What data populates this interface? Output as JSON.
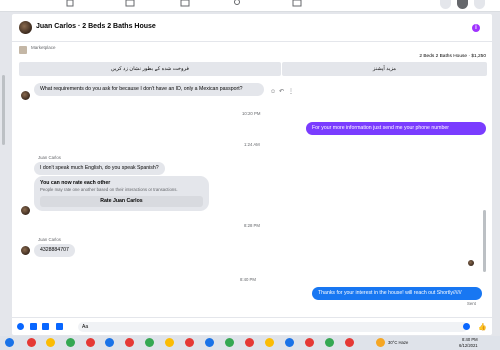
{
  "header": {
    "title": "Juan Carlos · 2 Beds 2 Baths House",
    "info_icon": "i"
  },
  "listing": {
    "marketplace_label": "Marketplace",
    "price_line": "2 Beds 2 Baths House · $1,250",
    "quick_replies": [
      "فروخت شده کے بطور نشان زد کریں",
      "مزید آپشنز"
    ]
  },
  "thread": {
    "msg1": "What requirements do you ask for because I don't have an ID, only a Mexican passport?",
    "ts1": "10:20 PM",
    "out1": "For your more information just send me your phone number",
    "ts2": "1:24 AM",
    "sender1": "Juan Carlos",
    "msg2": "I don't speak much English, do you speak Spanish?",
    "rate_title": "You can now rate each other",
    "rate_sub": "People may rate one another based on their interactions or transactions.",
    "rate_button": "Rate Juan Carlos",
    "ts3": "8:28 PM",
    "sender2": "Juan Carlos",
    "msg3": "4328884707",
    "ts4": "8:40 PM",
    "out2": "Thanks for your interest in the house! will reach out Shortly//////",
    "status": "Sent"
  },
  "composer": {
    "value": "Aa"
  },
  "taskbar": {
    "weather": "30°C  Haze",
    "time": "8:40 PM",
    "date": "6/12/2021"
  },
  "colors": {
    "outgoing_bubble": "#7a3cff",
    "outgoing_bubble_2": "#1877f2",
    "accent": "#0866ff"
  }
}
